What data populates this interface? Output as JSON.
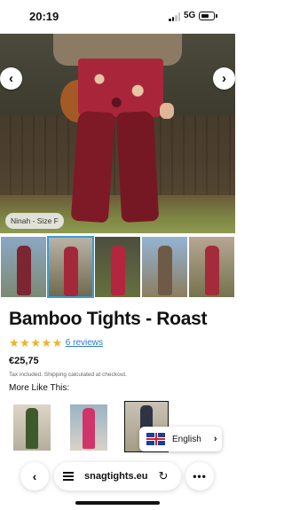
{
  "status_bar": {
    "time": "20:19",
    "network": "5G"
  },
  "product": {
    "title": "Bamboo Tights - Roast",
    "rating_stars": 5,
    "reviews_link": "6 reviews",
    "price": "€25,75",
    "tax_note": "Tax included. Shipping calculated at checkout.",
    "image_caption": "Ninah - Size F"
  },
  "gallery": {
    "thumbnail_count": 5,
    "selected_index": 1
  },
  "recommendations": {
    "heading": "More Like This:"
  },
  "language_switcher": {
    "label": "English"
  },
  "browser": {
    "url": "snagtights.eu"
  },
  "colors": {
    "accent_link": "#2b7bd0",
    "star": "#f0b225",
    "selected_border": "#3b9cd4"
  },
  "icons": [
    "chevron-left-icon",
    "chevron-right-icon",
    "star-icon",
    "uk-flag-icon",
    "tabs-icon",
    "reload-icon",
    "more-icon"
  ]
}
